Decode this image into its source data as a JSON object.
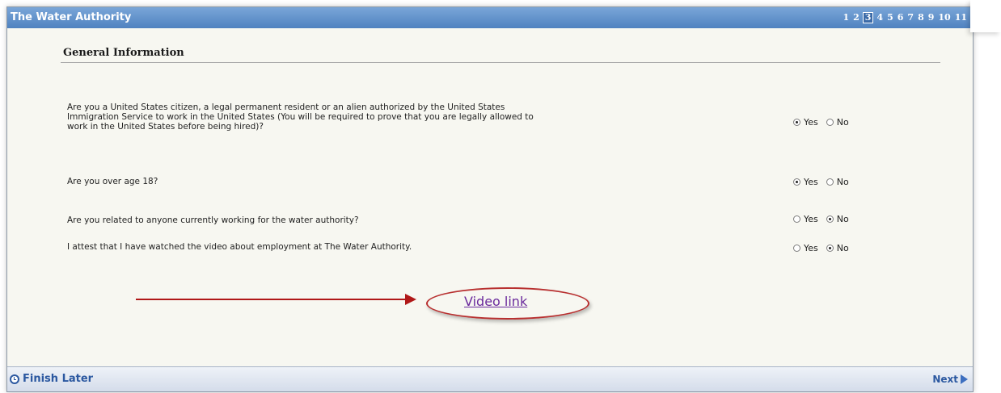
{
  "header": {
    "title": "The Water Authority",
    "pages": [
      "1",
      "2",
      "3",
      "4",
      "5",
      "6",
      "7",
      "8",
      "9",
      "10",
      "11"
    ],
    "current_page": "3"
  },
  "section": {
    "title": "General Information"
  },
  "questions": [
    {
      "text": "Are you a United States citizen, a legal permanent resident or an alien authorized by the United States\nImmigration Service to work in the United States (You will be required to prove that you are legally allowed to\nwork in the United States before being hired)?",
      "yes_label": "Yes",
      "no_label": "No",
      "selected": "Yes"
    },
    {
      "text": "Are you over age 18?",
      "yes_label": "Yes",
      "no_label": "No",
      "selected": "Yes"
    },
    {
      "text": "Are you related to anyone currently working for the water authority?",
      "yes_label": "Yes",
      "no_label": "No",
      "selected": "No"
    },
    {
      "text": "I attest that I have watched the video about employment at The Water Authority.",
      "yes_label": "Yes",
      "no_label": "No",
      "selected": "No"
    }
  ],
  "video": {
    "link_text": "Video link"
  },
  "footer": {
    "finish_later_label": "Finish Later",
    "next_label": "Next"
  },
  "colors": {
    "header_bar": "#4f82c0",
    "annotation_red": "#b01818",
    "link_purple": "#6a2a9c",
    "footer_link_blue": "#2b58a0"
  }
}
